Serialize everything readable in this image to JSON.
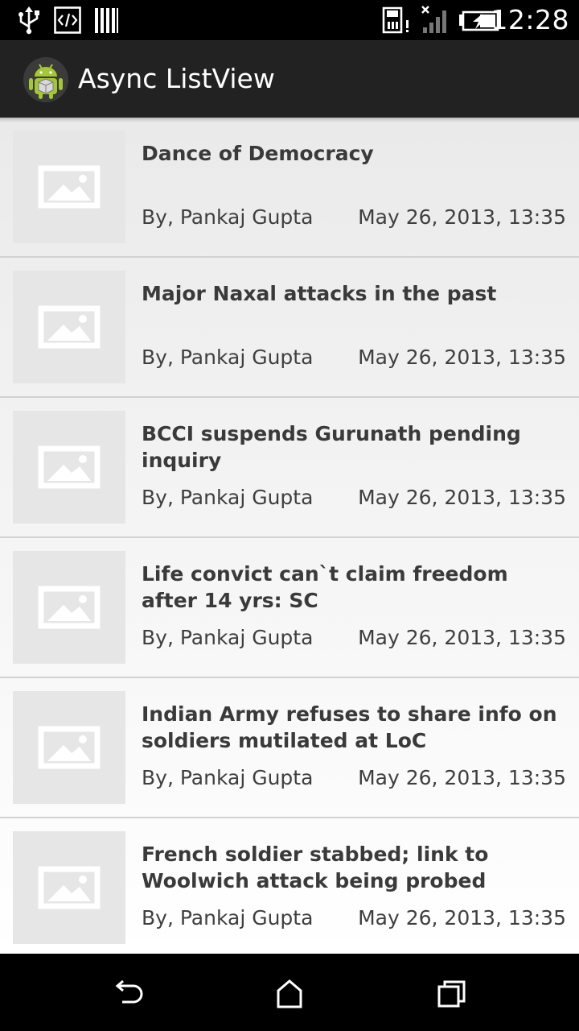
{
  "status_bar": {
    "time": "12:28",
    "icons": [
      "usb-icon",
      "developer-code-icon",
      "barcode-icon",
      "sd-card-alert-icon",
      "signal-no-service-icon",
      "battery-charging-icon"
    ]
  },
  "action_bar": {
    "app_icon": "android-app-icon",
    "title": "Async ListView"
  },
  "list": {
    "items": [
      {
        "title": "Dance of Democracy",
        "author": "By, Pankaj Gupta",
        "date": "May 26, 2013, 13:35",
        "thumbnail": "image-placeholder-icon"
      },
      {
        "title": "Major Naxal attacks in the past",
        "author": "By, Pankaj Gupta",
        "date": "May 26, 2013, 13:35",
        "thumbnail": "image-placeholder-icon"
      },
      {
        "title": "BCCI suspends Gurunath pending inquiry",
        "author": "By, Pankaj Gupta",
        "date": "May 26, 2013, 13:35",
        "thumbnail": "image-placeholder-icon"
      },
      {
        "title": "Life convict can`t claim freedom after 14 yrs: SC",
        "author": "By, Pankaj Gupta",
        "date": "May 26, 2013, 13:35",
        "thumbnail": "image-placeholder-icon"
      },
      {
        "title": "Indian Army refuses to share info on soldiers mutilated at LoC",
        "author": "By, Pankaj Gupta",
        "date": "May 26, 2013, 13:35",
        "thumbnail": "image-placeholder-icon"
      },
      {
        "title": "French soldier stabbed; link to Woolwich attack being probed",
        "author": "By, Pankaj Gupta",
        "date": "May 26, 2013, 13:35",
        "thumbnail": "image-placeholder-icon"
      }
    ]
  },
  "nav_bar": {
    "buttons": [
      "back-icon",
      "home-icon",
      "recent-apps-icon"
    ]
  },
  "colors": {
    "status_bar_bg": "#000000",
    "action_bar_bg": "#222222",
    "list_text": "#3a3a3a",
    "divider": "#d2d2d2"
  }
}
